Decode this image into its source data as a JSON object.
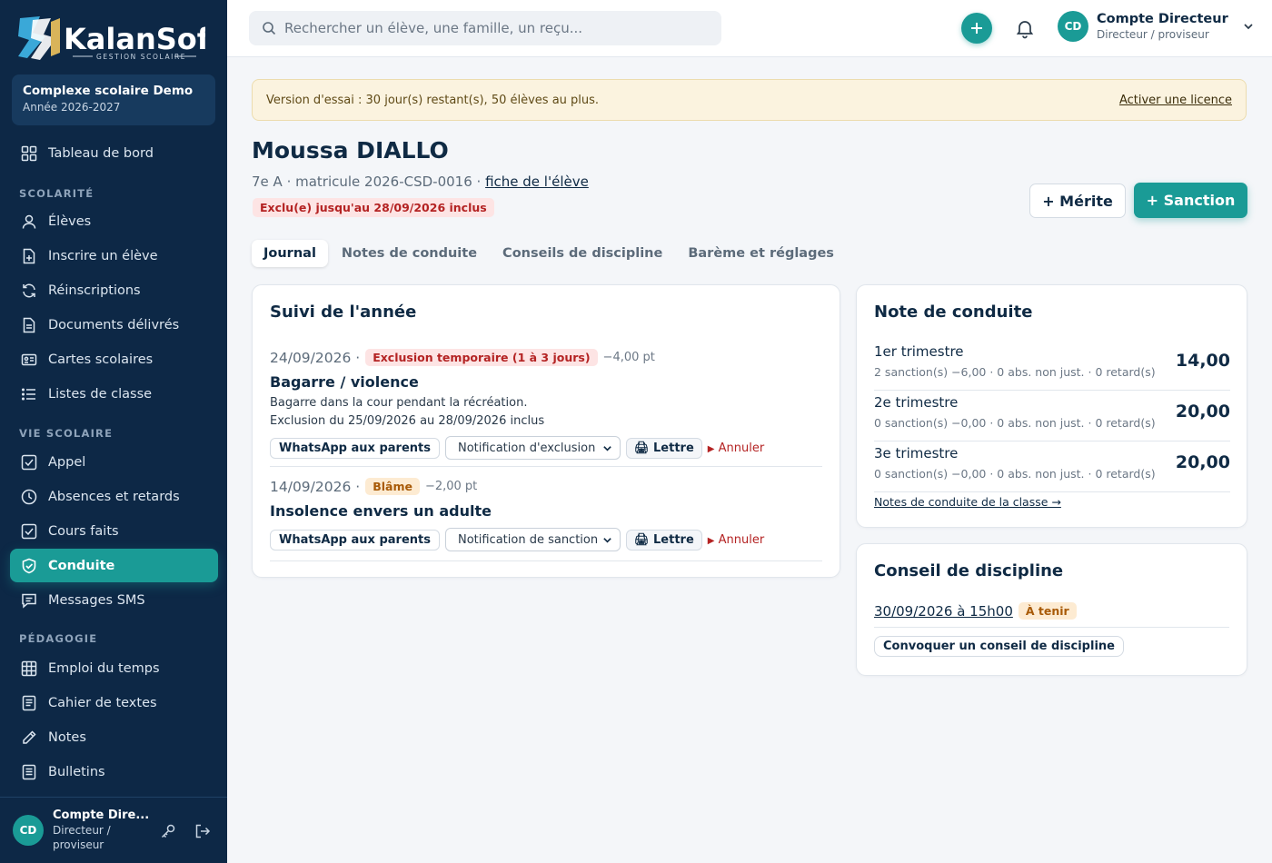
{
  "brand": {
    "name": "KalanSoft",
    "tagline": "GESTION SCOLAIRE"
  },
  "school": {
    "name": "Complexe scolaire Demo",
    "year": "Année 2026-2027"
  },
  "sidebar": {
    "dashboard": "Tableau de bord",
    "sections": [
      "SCOLARITÉ",
      "VIE SCOLAIRE",
      "PÉDAGOGIE"
    ],
    "scolarite": [
      "Élèves",
      "Inscrire un élève",
      "Réinscriptions",
      "Documents délivrés",
      "Cartes scolaires",
      "Listes de classe"
    ],
    "vie": [
      "Appel",
      "Absences et retards",
      "Cours faits",
      "Conduite",
      "Messages SMS"
    ],
    "pedagogie": [
      "Emploi du temps",
      "Cahier de textes",
      "Notes",
      "Bulletins"
    ],
    "active": "Conduite",
    "accent": "#1a9b96"
  },
  "footer_user": {
    "initials": "CD",
    "name": "Compte Dire...",
    "role": "Directeur / proviseur"
  },
  "header": {
    "search_placeholder": "Rechercher un élève, une famille, un reçu...",
    "user_initials": "CD",
    "user_name": "Compte Directeur",
    "user_role": "Directeur / proviseur"
  },
  "banner": {
    "text": "Version d'essai : 30 jour(s) restant(s), 50 élèves au plus.",
    "link": "Activer une licence"
  },
  "student": {
    "name": "Moussa DIALLO",
    "info": "7e A · matricule 2026-CSD-0016 · ",
    "fiche": "fiche de l'élève",
    "status": "Exclu(e) jusqu'au 28/09/2026 inclus"
  },
  "buttons": {
    "merite": "+ Mérite",
    "sanction": "+ Sanction"
  },
  "tabs": [
    "Journal",
    "Notes de conduite",
    "Conseils de discipline",
    "Barème et réglages"
  ],
  "journal": {
    "title": "Suivi de l'année",
    "entries": [
      {
        "date": "24/09/2026 ·",
        "badge": "Exclusion temporaire (1 à 3 jours)",
        "points": "−4,00 pt",
        "title": "Bagarre / violence",
        "desc1": "Bagarre dans la cour pendant la récréation.",
        "desc2": "Exclusion du 25/09/2026 au 28/09/2026 inclus",
        "whatsapp": "WhatsApp aux parents",
        "select": "Notification d'exclusion",
        "lettre": "🖨 Lettre",
        "annuler": "Annuler"
      },
      {
        "date": "14/09/2026 ·",
        "badge": "Blâme",
        "points": "−2,00 pt",
        "title": "Insolence envers un adulte",
        "whatsapp": "WhatsApp aux parents",
        "select": "Notification de sanction",
        "lettre": "🖨 Lettre",
        "annuler": "Annuler"
      }
    ]
  },
  "conduite": {
    "title": "Note de conduite",
    "trimestres": [
      {
        "label": "1er trimestre",
        "detail": "2 sanction(s) −6,00 · 0 abs. non just. · 0 retard(s)",
        "value": "14,00"
      },
      {
        "label": "2e trimestre",
        "detail": "0 sanction(s) −0,00 · 0 abs. non just. · 0 retard(s)",
        "value": "20,00"
      },
      {
        "label": "3e trimestre",
        "detail": "0 sanction(s) −0,00 · 0 abs. non just. · 0 retard(s)",
        "value": "20,00"
      }
    ],
    "link": "Notes de conduite de la classe →"
  },
  "conseil": {
    "title": "Conseil de discipline",
    "date": "30/09/2026 à 15h00",
    "badge": "À tenir",
    "button": "Convoquer un conseil de discipline"
  }
}
